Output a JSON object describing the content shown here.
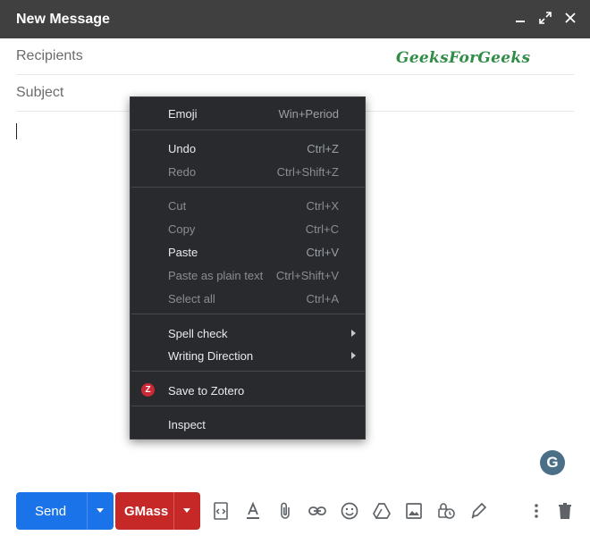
{
  "window": {
    "title": "New Message"
  },
  "compose": {
    "recipients_label": "Recipients",
    "subject_label": "Subject",
    "watermark": "GeeksForGeeks"
  },
  "context_menu": {
    "emoji": {
      "label": "Emoji",
      "shortcut": "Win+Period"
    },
    "undo": {
      "label": "Undo",
      "shortcut": "Ctrl+Z"
    },
    "redo": {
      "label": "Redo",
      "shortcut": "Ctrl+Shift+Z"
    },
    "cut": {
      "label": "Cut",
      "shortcut": "Ctrl+X"
    },
    "copy": {
      "label": "Copy",
      "shortcut": "Ctrl+C"
    },
    "paste": {
      "label": "Paste",
      "shortcut": "Ctrl+V"
    },
    "paste_plain": {
      "label": "Paste as plain text",
      "shortcut": "Ctrl+Shift+V"
    },
    "select_all": {
      "label": "Select all",
      "shortcut": "Ctrl+A"
    },
    "spell_check": {
      "label": "Spell check"
    },
    "writing_direction": {
      "label": "Writing Direction"
    },
    "save_zotero": {
      "label": "Save to Zotero",
      "icon_letter": "Z"
    },
    "inspect": {
      "label": "Inspect"
    }
  },
  "grammarly": {
    "letter": "G"
  },
  "toolbar": {
    "send_label": "Send",
    "gmass_label": "GMass"
  },
  "colors": {
    "titlebar": "#404040",
    "send": "#1a73e8",
    "gmass": "#c62828",
    "menu_bg": "#292a2d",
    "watermark": "#2f8d46"
  }
}
